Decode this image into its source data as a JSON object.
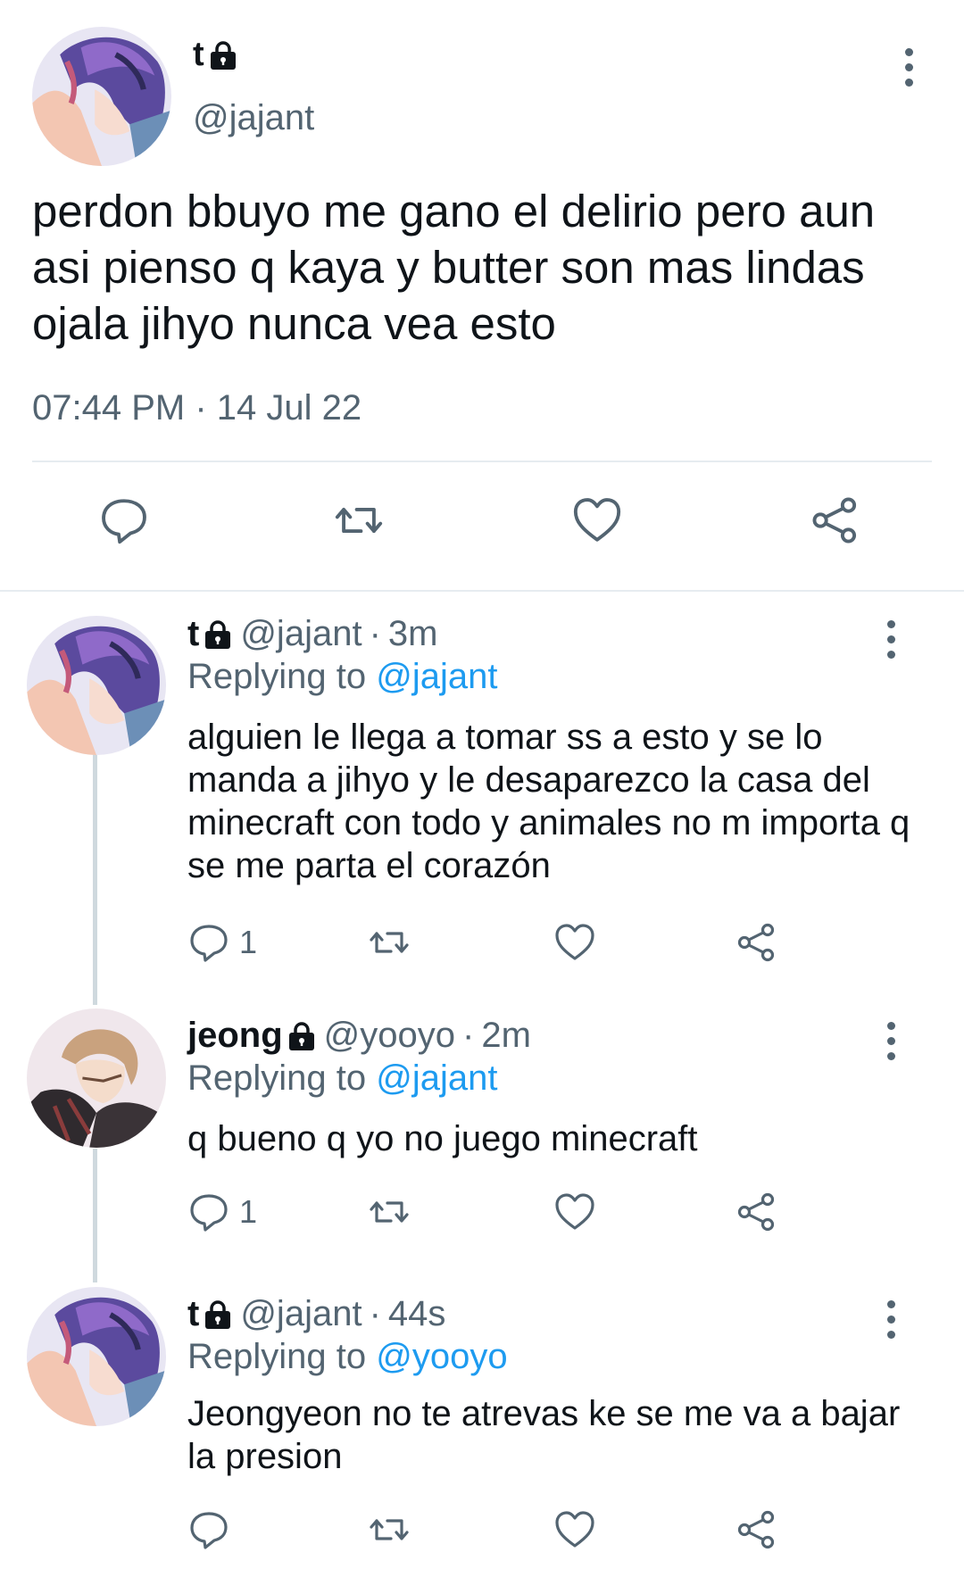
{
  "main_tweet": {
    "display_name": "t",
    "handle": "@jajant",
    "text": "perdon bbuyo me gano el delirio pero aun asi pienso q kaya y butter son mas lindas ojala jihyo nunca vea esto",
    "timestamp": "07:44 PM · 14 Jul 22"
  },
  "replies": [
    {
      "display_name": "t",
      "handle": "@jajant",
      "separator": "·",
      "time": "3m",
      "replying_prefix": "Replying to ",
      "replying_to": "@jajant",
      "text": "alguien le llega a tomar ss a esto y se lo manda a jihyo y le desaparezco la casa del minecraft con todo y animales no m importa q se me parta el corazón",
      "reply_count": "1"
    },
    {
      "display_name": "jeong",
      "handle": "@yooyo",
      "separator": "·",
      "time": "2m",
      "replying_prefix": "Replying to ",
      "replying_to": "@jajant",
      "text": "q bueno q yo no juego minecraft",
      "reply_count": "1"
    },
    {
      "display_name": "t",
      "handle": "@jajant",
      "separator": "·",
      "time": "44s",
      "replying_prefix": "Replying to ",
      "replying_to": "@yooyo",
      "text": "Jeongyeon no te atrevas ke se me va a bajar la presion",
      "reply_count": ""
    }
  ],
  "colors": {
    "text": "#0f1419",
    "secondary": "#536471",
    "link": "#1d9bf0",
    "divider": "#e6ecf0"
  },
  "icons": [
    "lock-icon",
    "more-icon",
    "reply-icon",
    "retweet-icon",
    "like-icon",
    "share-icon"
  ]
}
